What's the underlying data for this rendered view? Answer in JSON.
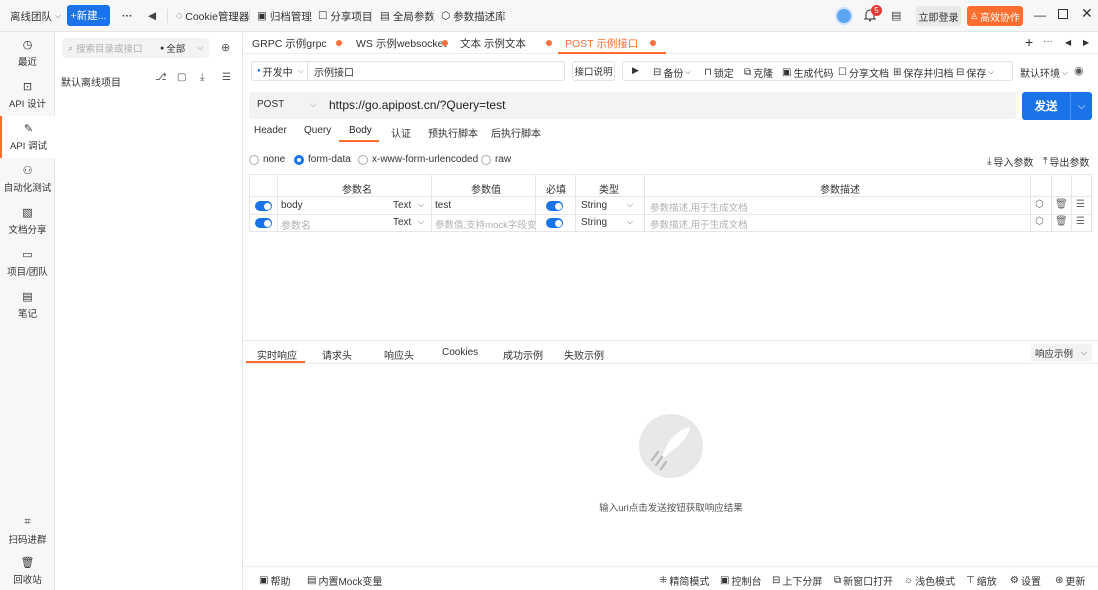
{
  "topbar": {
    "team": "离线团队",
    "new_btn": "+新建...",
    "more": "···",
    "cookie": "Cookie管理器",
    "archive": "归档管理",
    "share": "分享项目",
    "global_params": "全局参数",
    "param_desc": "参数描述库",
    "notif_count": "5",
    "login": "立即登录",
    "collab": "高效协作"
  },
  "nav": [
    {
      "label": "最近",
      "icon": "clock-icon"
    },
    {
      "label": "API 设计",
      "icon": "api-design-icon"
    },
    {
      "label": "API 调试",
      "icon": "api-debug-icon"
    },
    {
      "label": "自动化测试",
      "icon": "automation-icon"
    },
    {
      "label": "文档分享",
      "icon": "doc-share-icon"
    },
    {
      "label": "项目/团队",
      "icon": "project-team-icon"
    },
    {
      "label": "笔记",
      "icon": "note-icon"
    },
    {
      "label": "扫码进群",
      "icon": "qr-icon"
    },
    {
      "label": "回收站",
      "icon": "trash-icon"
    }
  ],
  "tree": {
    "search_placeholder": "搜索目录或接口",
    "filter": "全部",
    "project": "默认离线项目"
  },
  "tabs": [
    {
      "label": "GRPC 示例grpc"
    },
    {
      "label": "WS 示例websocket"
    },
    {
      "label": "文本 示例文本"
    },
    {
      "label": "POST 示例接口"
    }
  ],
  "request": {
    "status": "开发中",
    "name": "示例接口",
    "doc_btn": "接口说明",
    "backup": "备份",
    "lock": "锁定",
    "clone": "克隆",
    "gen_code": "生成代码",
    "share_doc": "分享文档",
    "save_archive": "保存并归档",
    "save": "保存",
    "env": "默认环境",
    "method": "POST",
    "url": "https://go.apipost.cn/?Query=test",
    "send": "发送"
  },
  "subtabs": [
    "Header",
    "Query",
    "Body",
    "认证",
    "预执行脚本",
    "后执行脚本"
  ],
  "body_modes": [
    "none",
    "form-data",
    "x-www-form-urlencoded",
    "raw"
  ],
  "import_params": "导入参数",
  "export_params": "导出参数",
  "table": {
    "headers": [
      "参数名",
      "参数值",
      "必填",
      "类型",
      "参数描述"
    ],
    "rows": [
      {
        "name": "body",
        "ftype": "Text",
        "value": "test",
        "type": "String",
        "desc": "参数描述,用于生成文档"
      },
      {
        "name": "参数名",
        "ftype": "Text",
        "value": "参数值,支持mock字段变",
        "type": "String",
        "desc": "参数描述,用于生成文档"
      }
    ]
  },
  "resp_tabs": [
    "实时响应",
    "请求头",
    "响应头",
    "Cookies",
    "成功示例",
    "失败示例"
  ],
  "resp_example": "响应示例",
  "empty_hint": "输入url点击发送按钮获取响应结果",
  "bottom": {
    "help": "帮助",
    "mock": "内置Mock变量",
    "simple": "精简模式",
    "console": "控制台",
    "split": "上下分屏",
    "new_window": "新窗口打开",
    "theme": "浅色模式",
    "zoom": "缩放",
    "settings": "设置",
    "update": "更新"
  },
  "colors": {
    "accent": "#ff6e2e",
    "primary": "#1a73e8"
  }
}
